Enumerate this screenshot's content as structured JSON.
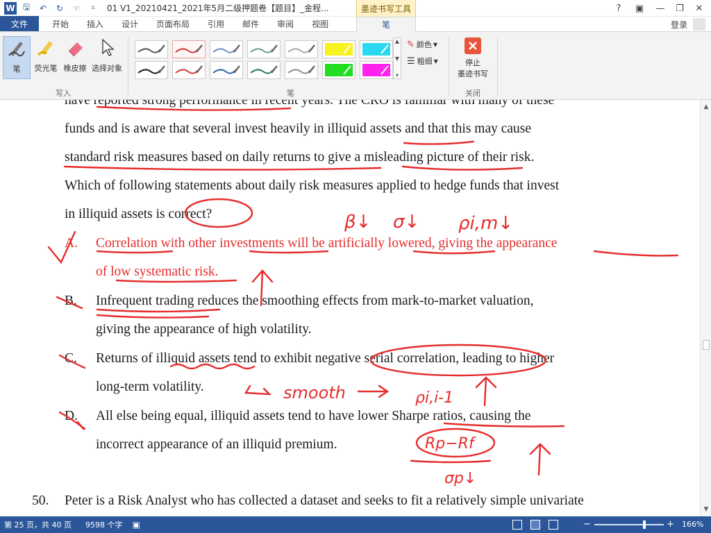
{
  "window": {
    "title": "01 V1_20210421_2021年5月二级押题卷【题目】_金程...",
    "context_tab_group": "墨迹书写工具",
    "controls": [
      "?",
      "▣",
      "—",
      "❐",
      "✕"
    ]
  },
  "tabs": {
    "file": "文件",
    "items": [
      "开始",
      "插入",
      "设计",
      "页面布局",
      "引用",
      "邮件",
      "审阅",
      "视图"
    ],
    "active": "笔",
    "login": "登录"
  },
  "ribbon": {
    "write_group": {
      "label": "写入",
      "buttons": [
        {
          "label": "笔",
          "icon": "pen-icon",
          "selected": true
        },
        {
          "label": "荧光笔",
          "icon": "highlighter-icon",
          "selected": false
        },
        {
          "label": "橡皮擦",
          "icon": "eraser-icon",
          "selected": false
        },
        {
          "label": "选择对象",
          "icon": "select-cursor-icon",
          "selected": false
        }
      ]
    },
    "pens_group": {
      "label": "笔",
      "pen_colors": [
        "#555555",
        "#d23a3a",
        "#6f8dbf",
        "#6a9f8a",
        "#a9a9a9",
        "#f8f21e",
        "#2ad8f0",
        "#1a1a1a",
        "#d23a3a",
        "#2f63b0",
        "#2a7a5a",
        "#8f8f8f",
        "#22dd22",
        "#ff22ee"
      ],
      "selected_index": 1,
      "color_label": "颜色",
      "thickness_label": "粗细"
    },
    "close_group": {
      "label": "关闭",
      "stop_label_1": "停止",
      "stop_label_2": "墨迹书写"
    }
  },
  "document": {
    "question_text": [
      "have reported strong performance in recent years. The CRO is familiar with many of these",
      "funds and is aware that several invest heavily in illiquid assets and that this may cause",
      "standard risk measures based on daily returns to give a misleading picture of their risk.",
      "Which of following statements about daily risk measures applied to hedge funds that invest",
      "in illiquid assets is correct?"
    ],
    "options": [
      {
        "letter": "A.",
        "lines": [
          "Correlation with other investments will be artificially lowered, giving the appearance",
          "of low systematic risk."
        ],
        "highlight": true
      },
      {
        "letter": "B.",
        "lines": [
          "Infrequent trading reduces the smoothing effects from mark-to-market valuation,",
          "giving the appearance of high volatility."
        ],
        "highlight": false
      },
      {
        "letter": "C.",
        "lines": [
          "Returns of illiquid assets tend to exhibit negative serial correlation, leading to higher",
          "long-term volatility."
        ],
        "highlight": false
      },
      {
        "letter": "D.",
        "lines": [
          "All else being equal, illiquid assets tend to have lower Sharpe ratios, causing the",
          "incorrect appearance of an illiquid premium."
        ],
        "highlight": false
      }
    ],
    "next_question": {
      "number": "50.",
      "text": "Peter is a Risk Analyst who has collected a dataset and seeks to fit a relatively simple univariate"
    },
    "ink_annotations": [
      "β↓",
      "σ↓",
      "ρi,m↓",
      "smooth",
      "ρi,i-1",
      "Rp−Rf",
      "σp↓"
    ]
  },
  "status": {
    "page": "第 25 页，共 40 页",
    "words": "9598 个字",
    "zoom": "166%",
    "zoom_minus": "−",
    "zoom_plus": "+"
  },
  "colors": {
    "brand": "#2b579a",
    "ink_red": "#e52c2c"
  }
}
